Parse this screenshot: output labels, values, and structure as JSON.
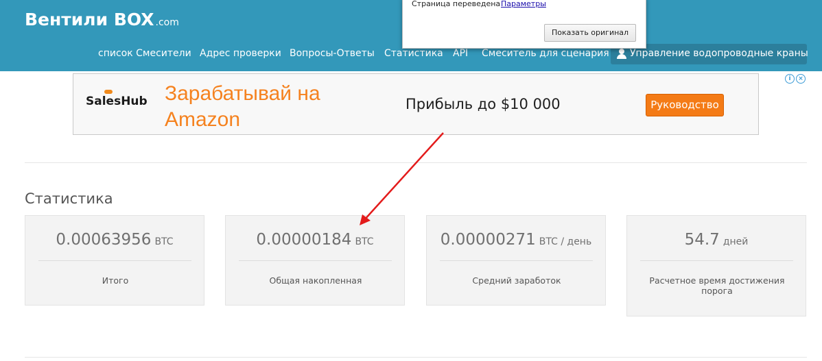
{
  "header": {
    "brand": "Вентили BOX",
    "brand_suffix": ".com",
    "nav": [
      {
        "label": "список Смесители"
      },
      {
        "label": "Адрес проверки"
      },
      {
        "label": "Вопросы-Ответы"
      },
      {
        "label": "Статистика"
      },
      {
        "label": "API"
      },
      {
        "label": "Смеситель для сценария"
      }
    ],
    "account_label": "Управление водопроводные краны"
  },
  "translate_popup": {
    "text": "Страница переведена",
    "link": "Параметры",
    "button": "Показать оригинал"
  },
  "ad": {
    "logo": "SalesHub",
    "headline": "Зарабатывай на Amazon",
    "offer": "Прибыль до $10 000",
    "button": "Руководство",
    "choices_icons": [
      "info-icon",
      "close-icon"
    ]
  },
  "stats": {
    "title": "Статистика",
    "cards": [
      {
        "value": "0.00063956",
        "unit": "BTC",
        "label": "Итого"
      },
      {
        "value": "0.00000184",
        "unit": "BTC",
        "label": "Общая накопленная"
      },
      {
        "value": "0.00000271",
        "unit": "BTC / день",
        "label": "Средний заработок"
      },
      {
        "value": "54.7",
        "unit": "дней",
        "label": "Расчетное время достижения порога"
      }
    ]
  },
  "annotation": {
    "color": "#e31b1b"
  }
}
